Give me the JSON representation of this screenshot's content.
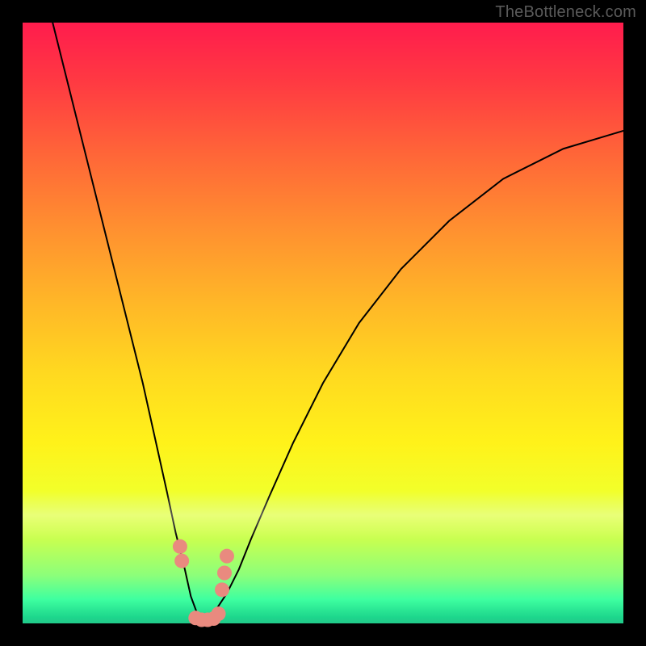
{
  "watermark": {
    "text": "TheBottleneck.com"
  },
  "chart_data": {
    "type": "line",
    "title": "",
    "xlabel": "",
    "ylabel": "",
    "xlim": [
      0,
      100
    ],
    "ylim": [
      0,
      100
    ],
    "grid": false,
    "legend": false,
    "background_gradient": {
      "top": "#ff1c4d",
      "mid": "#fff21a",
      "bottom": "#22c98a"
    },
    "series": [
      {
        "name": "bottleneck-curve",
        "color": "#000000",
        "stroke_width": 2,
        "x": [
          5,
          8,
          11,
          14,
          17,
          20,
          22,
          24,
          25.5,
          27,
          28,
          29,
          30,
          31,
          32,
          34,
          36,
          38,
          41,
          45,
          50,
          56,
          63,
          71,
          80,
          90,
          100
        ],
        "y": [
          100,
          88,
          76,
          64,
          52,
          40,
          31,
          22,
          15,
          9,
          4.5,
          1.8,
          0.6,
          0.6,
          2,
          5,
          9,
          14,
          21,
          30,
          40,
          50,
          59,
          67,
          74,
          79,
          82
        ]
      }
    ],
    "annotations": [
      {
        "name": "valley-markers",
        "type": "scatter",
        "color": "#e98a7f",
        "radius": 9,
        "x": [
          26.2,
          26.5,
          28.8,
          29.8,
          30.8,
          31.8,
          32.6,
          33.2,
          33.6,
          34.0
        ],
        "y": [
          12.8,
          10.4,
          0.9,
          0.6,
          0.6,
          0.8,
          1.6,
          5.6,
          8.4,
          11.2
        ]
      }
    ]
  }
}
